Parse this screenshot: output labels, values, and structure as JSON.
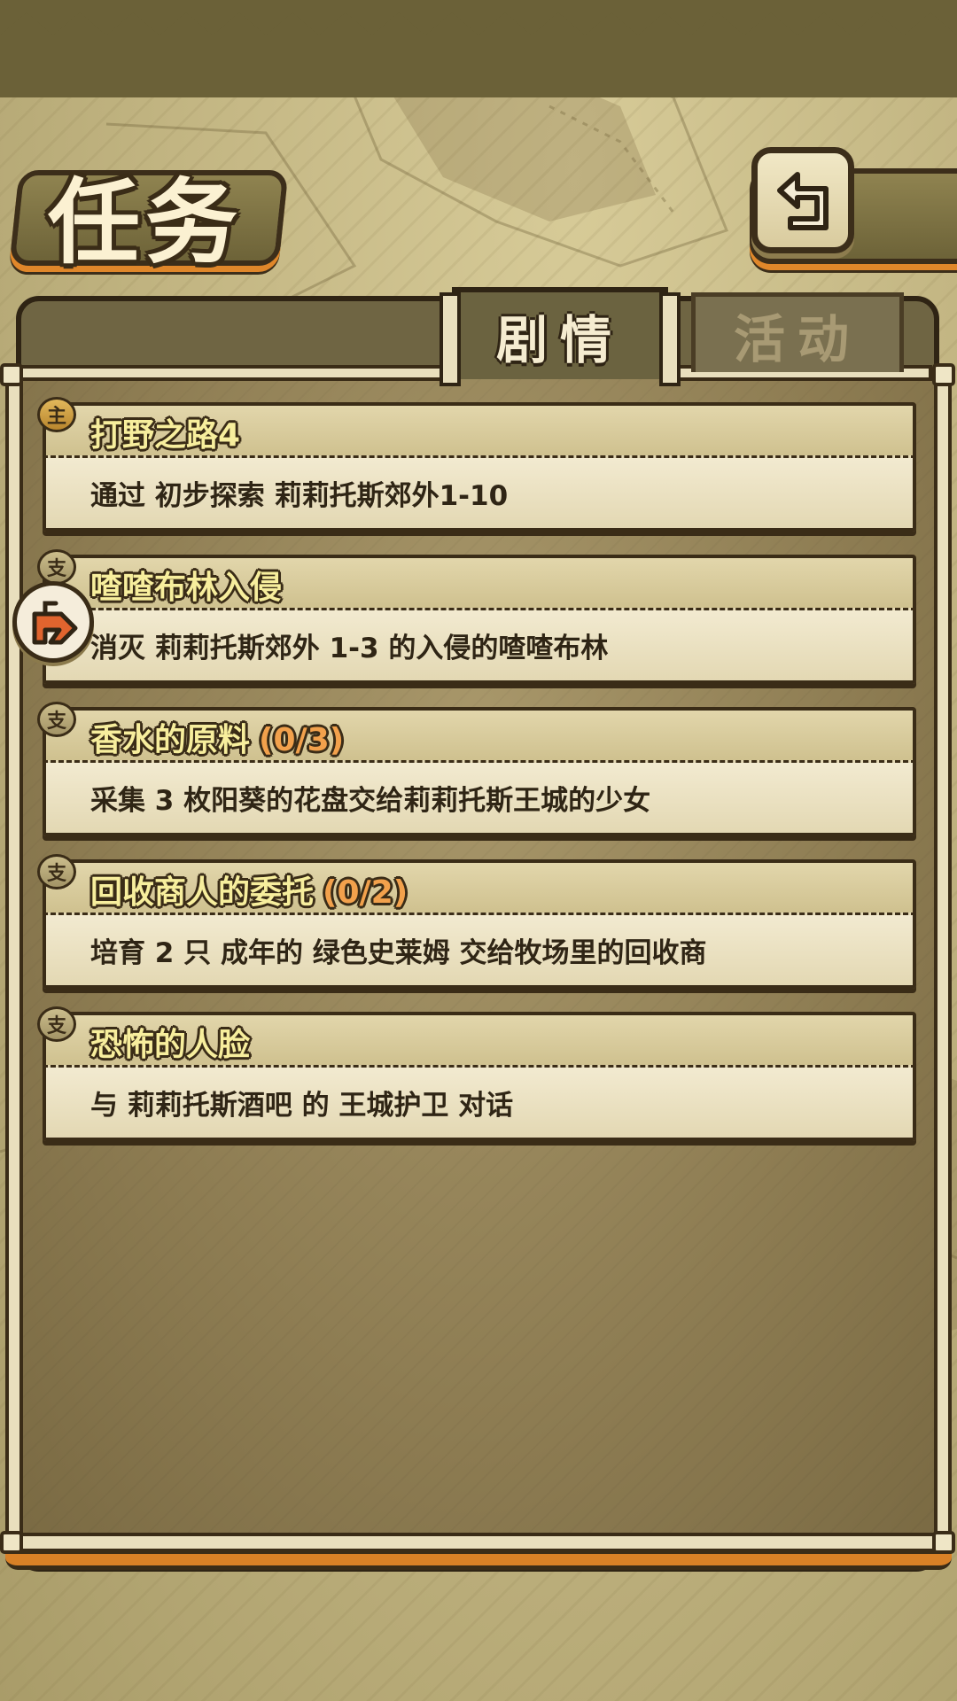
{
  "header": {
    "title": "任务",
    "back_icon": "back-return-icon"
  },
  "tabs": [
    {
      "label": "剧情",
      "active": true
    },
    {
      "label": "活动",
      "active": false
    }
  ],
  "quests": [
    {
      "type_badge": "主",
      "type": "main",
      "title": "打野之路4",
      "progress": "",
      "description": "通过 初步探索 莉莉托斯郊外1-10"
    },
    {
      "type_badge": "支",
      "type": "side",
      "title": "喳喳布林入侵",
      "progress": "",
      "description": "消灭 莉莉托斯郊外 1-3 的入侵的喳喳布林",
      "tracked": true
    },
    {
      "type_badge": "支",
      "type": "side",
      "title": "香水的原料",
      "progress": "(0/3)",
      "description": "采集 3 枚阳葵的花盘交给莉莉托斯王城的少女"
    },
    {
      "type_badge": "支",
      "type": "side",
      "title": "回收商人的委托",
      "progress": "(0/2)",
      "description": "培育 2 只 成年的 绿色史莱姆 交给牧场里的回收商"
    },
    {
      "type_badge": "支",
      "type": "side",
      "title": "恐怖的人脸",
      "progress": "",
      "description": "与 莉莉托斯酒吧 的 王城护卫 对话"
    }
  ],
  "colors": {
    "title_yellow": "#f7ee9d",
    "progress_orange": "#f2a14c",
    "border_dark": "#3a2c17",
    "accent_orange": "#e0872a"
  }
}
